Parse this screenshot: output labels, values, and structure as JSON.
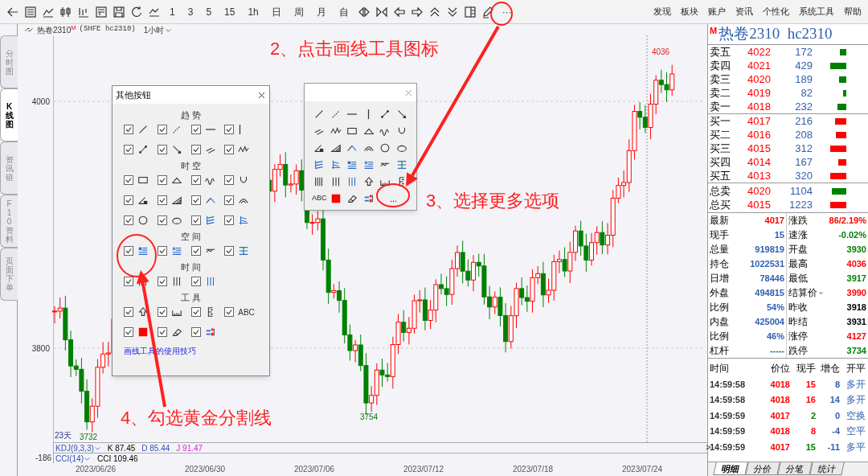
{
  "toolbar": {
    "periods": [
      "1",
      "3",
      "5",
      "15",
      "1h",
      "日",
      "周",
      "月",
      "自"
    ],
    "more": "···",
    "menu": [
      "发现",
      "板块",
      "账户",
      "资讯",
      "个性化",
      "系统工具",
      "帮助"
    ]
  },
  "side_tabs": [
    {
      "label": "分时图",
      "selected": false
    },
    {
      "label": "K线图",
      "selected": true
    },
    {
      "label": "资讯链",
      "selected": false
    },
    {
      "label": "F10资料",
      "selected": false
    },
    {
      "label": "页面下单",
      "selected": false
    }
  ],
  "chart_header": {
    "name": "热卷2310",
    "mark": "M",
    "code": "(SHFE hc2310)",
    "period": "1小时"
  },
  "chart": {
    "price_labels": [
      "4000",
      "3800"
    ],
    "high_label": "4036",
    "low_labels": [
      "3754",
      "3732"
    ],
    "days_label": "23天",
    "dates": [
      "2023/06/26",
      "2023/06/30",
      "2023/07/06",
      "2023/07/12",
      "2023/07/18",
      "2023/07/24"
    ]
  },
  "indicators": [
    {
      "name": "KDJ(9,3,3)",
      "values": [
        {
          "text": "K 87.45",
          "color": "#000000"
        },
        {
          "text": "D 85.44",
          "color": "#3050c0"
        },
        {
          "text": "J 91.47",
          "color": "#e020e0"
        }
      ]
    },
    {
      "name": "CCI(14)",
      "axis_label": "-186",
      "values": [
        {
          "text": "CCI 109.46",
          "color": "#000000"
        }
      ]
    }
  ],
  "dialog": {
    "title": "其他按钮",
    "sections": [
      {
        "title": "趋 势",
        "items": [
          {
            "checked": true
          },
          {
            "checked": true
          },
          {
            "checked": true
          },
          {
            "checked": true
          },
          {
            "checked": true
          },
          {
            "checked": true
          },
          {
            "checked": true
          },
          {
            "checked": true
          }
        ]
      },
      {
        "title": "时 空",
        "items": [
          {
            "checked": true
          },
          {
            "checked": true
          },
          {
            "checked": true
          },
          {
            "checked": true
          },
          {
            "checked": true
          },
          {
            "checked": true
          },
          {
            "checked": true
          },
          {
            "checked": true
          },
          {
            "checked": true
          },
          {
            "checked": true
          },
          {
            "checked": true
          },
          {
            "checked": true
          }
        ]
      },
      {
        "title": "空 间",
        "items": [
          {
            "checked": true
          },
          {
            "checked": true
          },
          {
            "checked": true
          },
          {
            "checked": true
          }
        ]
      },
      {
        "title": "时 间",
        "items": [
          {
            "checked": true
          },
          {
            "checked": true
          },
          {
            "checked": true
          }
        ]
      },
      {
        "title": "工 具",
        "items": [
          {
            "checked": true
          },
          {
            "checked": true
          },
          {
            "checked": true
          },
          {
            "checked": true,
            "label": "ABC"
          },
          {
            "checked": true
          },
          {
            "checked": true
          },
          {
            "checked": true
          }
        ]
      }
    ],
    "link": "画线工具的使用技巧"
  },
  "palette": {
    "abc_label": "ABC",
    "more_label": "..."
  },
  "annotations": [
    "2、点击画线工具图标",
    "3、选择更多选项",
    "4、勾选黄金分割线"
  ],
  "quote": {
    "mark": "M",
    "title": "热卷2310  hc2310",
    "asks": [
      {
        "label": "卖五",
        "price": "4022",
        "volume": "172"
      },
      {
        "label": "卖四",
        "price": "4021",
        "volume": "429"
      },
      {
        "label": "卖三",
        "price": "4020",
        "volume": "189"
      },
      {
        "label": "卖二",
        "price": "4019",
        "volume": "82"
      },
      {
        "label": "卖一",
        "price": "4018",
        "volume": "232"
      }
    ],
    "bids": [
      {
        "label": "买一",
        "price": "4017",
        "volume": "216"
      },
      {
        "label": "买二",
        "price": "4016",
        "volume": "208"
      },
      {
        "label": "买三",
        "price": "4015",
        "volume": "312"
      },
      {
        "label": "买四",
        "price": "4014",
        "volume": "167"
      },
      {
        "label": "买五",
        "price": "4013",
        "volume": "320"
      }
    ],
    "totals": [
      {
        "label": "总卖",
        "price": "4020",
        "volume": "1104",
        "color": "#008000"
      },
      {
        "label": "总买",
        "price": "4015",
        "volume": "1223",
        "color": "#ff0000"
      }
    ],
    "stats_left": [
      {
        "label": "最新",
        "value": "4017",
        "color": "#ff0000"
      },
      {
        "label": "现手",
        "value": "15",
        "color": "#3060b0"
      },
      {
        "label": "总量",
        "value": "919819",
        "color": "#3060b0"
      },
      {
        "label": "持仓",
        "value": "1022531",
        "color": "#3060b0"
      },
      {
        "label": "日增",
        "value": "78446",
        "color": "#3060b0"
      },
      {
        "label": "外盘",
        "value": "494815",
        "color": "#3060b0"
      },
      {
        "label": "比例",
        "value": "54%",
        "color": "#3060b0"
      },
      {
        "label": "内盘",
        "value": "425004",
        "color": "#3060b0"
      },
      {
        "label": "比例",
        "value": "46%",
        "color": "#3060b0"
      },
      {
        "label": "杠杆",
        "value": "-----",
        "color": "#3060b0"
      }
    ],
    "stats_right": [
      {
        "label": "涨跌",
        "value": "86/2.19%",
        "color": "#ff0000"
      },
      {
        "label": "速涨",
        "value": "-0.02%",
        "color": "#008000"
      },
      {
        "label": "开盘",
        "value": "3930",
        "color": "#008000"
      },
      {
        "label": "最高",
        "value": "4036",
        "color": "#ff0000"
      },
      {
        "label": "最低",
        "value": "3917",
        "color": "#008000"
      },
      {
        "label": "结算价",
        "value": "3990",
        "color": "#ff0000",
        "dropdown": true
      },
      {
        "label": "昨收",
        "value": "3918",
        "color": "#000000"
      },
      {
        "label": "昨结",
        "value": "3931",
        "color": "#000000"
      },
      {
        "label": "涨停",
        "value": "4127",
        "color": "#ff0000"
      },
      {
        "label": "跌停",
        "value": "3734",
        "color": "#008000"
      }
    ],
    "trade_columns": [
      "时间",
      "价位",
      "现手",
      "增仓",
      "开平"
    ],
    "trades": [
      {
        "time": "14:59:58",
        "price": "4018",
        "volume": "15",
        "color": "#ff0000",
        "change": "8",
        "type": "多开"
      },
      {
        "time": "14:59:58",
        "price": "4018",
        "volume": "16",
        "color": "#ff0000",
        "change": "14",
        "type": "多开"
      },
      {
        "time": "14:59:59",
        "price": "4017",
        "volume": "2",
        "color": "#008000",
        "change": "0",
        "type": "空换"
      },
      {
        "time": "14:59:59",
        "price": "4018",
        "volume": "8",
        "color": "#ff0000",
        "change": "-4",
        "type": "空平"
      },
      {
        "pointer": ">",
        "time": "14:59:59",
        "price": "4017",
        "volume": "15",
        "color": "#008000",
        "change": "-11",
        "type": "多平"
      }
    ],
    "bottom_tabs": [
      {
        "label": "明细",
        "selected": true
      },
      {
        "label": "分价",
        "selected": false
      },
      {
        "label": "分笔",
        "selected": false
      },
      {
        "label": "统计",
        "selected": false
      }
    ]
  }
}
